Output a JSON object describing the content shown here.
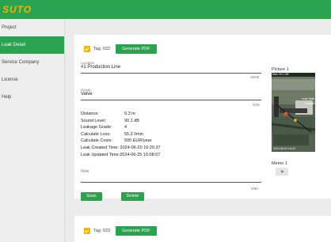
{
  "brand": {
    "logo_text": "SUTO"
  },
  "sidebar": {
    "items": [
      {
        "label": "Project"
      },
      {
        "label": "Leak Detail"
      },
      {
        "label": "Service Company"
      },
      {
        "label": "License"
      },
      {
        "label": "Help"
      }
    ]
  },
  "record1": {
    "tag_label": "Tag: 022",
    "generate_pdf_label": "Generate PDF",
    "location": {
      "label": "Location",
      "value": "#1 Production Line",
      "counter": "18/25"
    },
    "group": {
      "label": "Group",
      "value": "Valve",
      "counter": "5/25"
    },
    "details": [
      {
        "label": "Distance:",
        "value": "0.3 m"
      },
      {
        "label": "Sound Level:",
        "value": "90.1 dB"
      },
      {
        "label": "Leakage Grade:",
        "value": "4"
      },
      {
        "label": "Calculate Loss:",
        "value": "55.2 l/min"
      },
      {
        "label": "Calculate Costs:",
        "value": "500 EUR/year"
      },
      {
        "label": "Leak Created Time:",
        "value": "2024-06-20 16:20:37"
      },
      {
        "label": "Leak Updated Time:",
        "value": "2024-06-25 15:08:07"
      }
    ],
    "note": {
      "label": "Note",
      "value": "",
      "counter": "0/80"
    },
    "save_label": "Save",
    "delete_label": "Delete",
    "picture": {
      "title": "Picture 1",
      "overlay_top_left": "Max: 90.1 dB",
      "overlay_top_right": "Leak Rate",
      "overlay_sub": "Contact",
      "timestamp": "2024-06-20 16:20"
    },
    "memo": {
      "title": "Memo 1"
    }
  },
  "record2": {
    "tag_label": "Tag: 023",
    "generate_pdf_label": "Generate PDF"
  },
  "colors": {
    "accent": "#2aa24f",
    "checkbox": "#f0b400",
    "background": "#ececec"
  }
}
